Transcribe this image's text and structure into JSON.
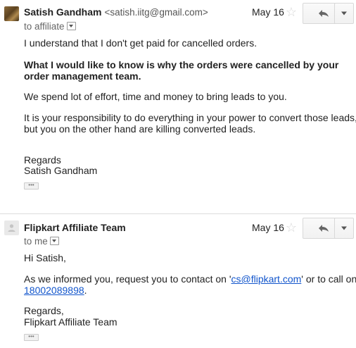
{
  "message1": {
    "sender_name": "Satish Gandham",
    "sender_email": "<satish.iitg@gmail.com>",
    "date": "May 16",
    "recipient": "to affiliate",
    "body": {
      "p1": "I understand that I don't get paid for cancelled orders.",
      "p2_line1": "What I would like to know is why the orders were cancelled by your",
      "p2_line2": "order management team.",
      "p3": "We spend lot of effort, time and money to bring leads to you.",
      "p4_line1": "It is your responsibility to do everything in your power to convert those leads,",
      "p4_line2": "but you on the other hand are killing converted leads.",
      "sign1": "Regards",
      "sign2": "Satish Gandham"
    },
    "ellipsis": "•••"
  },
  "message2": {
    "sender_name": "Flipkart Affiliate Team",
    "date": "May 16",
    "recipient": "to me",
    "body": {
      "greeting": "Hi Satish,",
      "p1_before": "As we informed you, request you to contact on '",
      "p1_email": "cs@flipkart.com",
      "p1_after": "' or to call on",
      "phone": "18002089898",
      "phone_after": ".",
      "sign1": "Regards,",
      "sign2": "Flipkart Affiliate Team"
    },
    "ellipsis": "•••"
  },
  "icons": {
    "star": "star-icon",
    "reply": "reply-arrow-icon",
    "more": "chevron-down-icon",
    "avatar_default": "default-avatar-icon"
  },
  "colors": {
    "link": "#1155cc",
    "star": "#d6d6d6",
    "divider": "#dddddd"
  }
}
